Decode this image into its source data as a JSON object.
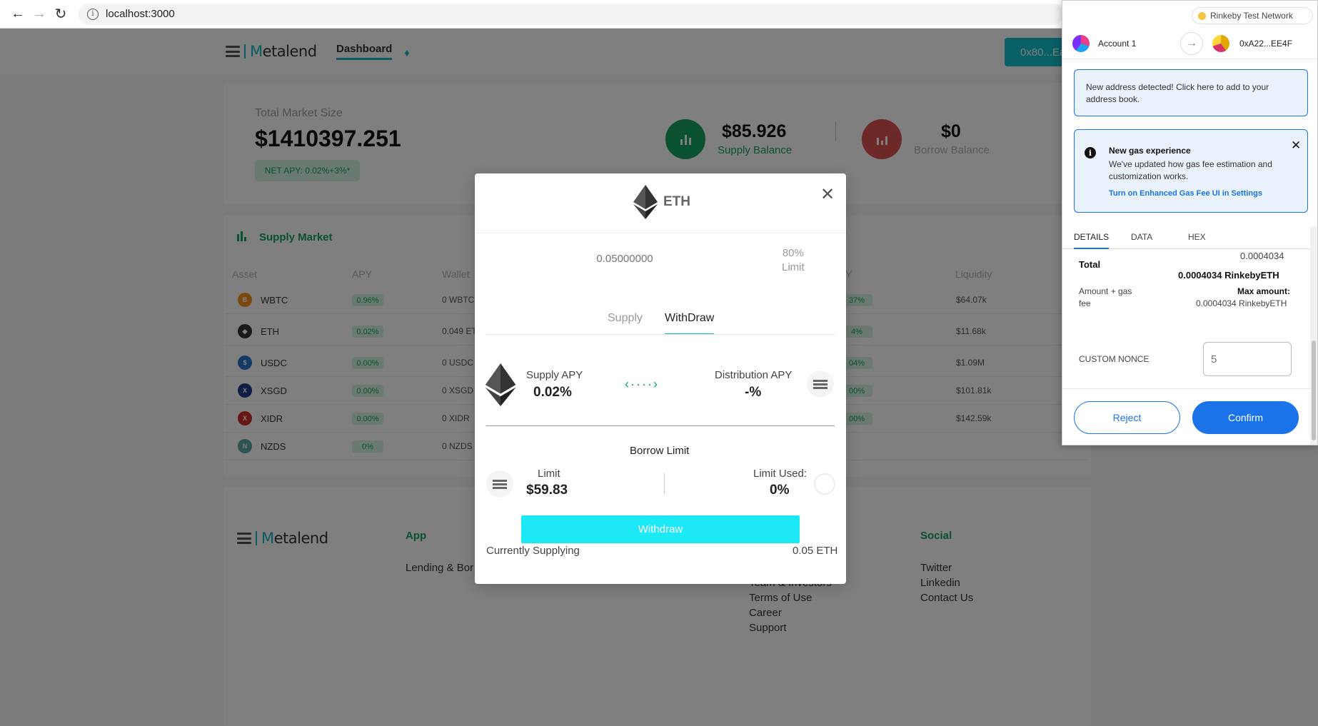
{
  "browser": {
    "url": "localhost:3000"
  },
  "header": {
    "logo_prefix": "M",
    "logo_rest": "etalend",
    "nav_dashboard": "Dashboard",
    "account_button": "0x80...Ea"
  },
  "market": {
    "total_label": "Total Market Size",
    "total_value": "$1410397.251",
    "net_apy": "NET APY: 0.02%+3%*",
    "supply_balance_value": "$85.926",
    "supply_balance_label": "Supply Balance",
    "borrow_balance_value": "$0",
    "borrow_balance_label": "Borrow Balance"
  },
  "supply_market": {
    "title": "Supply Market",
    "headers": {
      "asset": "Asset",
      "apy": "APY",
      "wallet": "Wallet",
      "apy2": "Y",
      "liquidity": "Liquidity"
    },
    "rows": [
      {
        "name": "WBTC",
        "apy": "0.96%",
        "wallet": "0 WBTC",
        "borrow_apy": "37%",
        "liquidity": "$64.07k",
        "color": "#f7931a",
        "glyph": "B"
      },
      {
        "name": "ETH",
        "apy": "0.02%",
        "wallet": "0.049 ET",
        "borrow_apy": "4%",
        "liquidity": "$11.68k",
        "color": "#333333",
        "glyph": "◆"
      },
      {
        "name": "USDC",
        "apy": "0.00%",
        "wallet": "0 USDC",
        "borrow_apy": "04%",
        "liquidity": "$1.09M",
        "color": "#2775ca",
        "glyph": "$"
      },
      {
        "name": "XSGD",
        "apy": "0.00%",
        "wallet": "0 XSGD",
        "borrow_apy": "00%",
        "liquidity": "$101.81k",
        "color": "#1d3c8f",
        "glyph": "X"
      },
      {
        "name": "XIDR",
        "apy": "0.00%",
        "wallet": "0 XIDR",
        "borrow_apy": "00%",
        "liquidity": "$142.59k",
        "color": "#d12b2b",
        "glyph": "X"
      },
      {
        "name": "NZDS",
        "apy": "0%",
        "wallet": "0 NZDS",
        "borrow_apy": "",
        "liquidity": "",
        "color": "#5aa6a0",
        "glyph": "N"
      }
    ]
  },
  "footer": {
    "app_title": "App",
    "app_link": "Lending & Bor",
    "company_partial": "Team & Investors",
    "company_links": [
      "Terms of Use",
      "Career",
      "Support"
    ],
    "social_title": "Social",
    "social_links": [
      "Twitter",
      "Linkedin",
      "Contact Us"
    ]
  },
  "modal": {
    "asset": "ETH",
    "amount_placeholder": "0.05000000",
    "limit_pct": "80%",
    "limit_label": "Limit",
    "tab_supply": "Supply",
    "tab_withdraw": "WithDraw",
    "supply_apy_label": "Supply APY",
    "supply_apy_value": "0.02%",
    "dist_apy_label": "Distribution APY",
    "dist_apy_value": "-%",
    "borrow_limit_title": "Borrow Limit",
    "limit_title": "Limit",
    "limit_value": "$59.83",
    "limit_used_label": "Limit Used:",
    "limit_used_value": "0%",
    "withdraw_button": "Withdraw",
    "currently_supplying_label": "Currently Supplying",
    "currently_supplying_value": "0.05 ETH",
    "close_icon": "close-icon"
  },
  "metamask": {
    "network": "Rinkeby Test Network",
    "from_account": "Account 1",
    "to_address": "0xA22...EE4F",
    "notice_address": "New address detected! Click here to add to your address book.",
    "gas_title": "New gas experience",
    "gas_body": "We've updated how gas fee estimation and customization works.",
    "gas_link": "Turn on Enhanced Gas Fee UI in Settings",
    "tabs": [
      "DETAILS",
      "DATA",
      "HEX"
    ],
    "total_top": "0.0004034",
    "total_label": "Total",
    "total_value": "0.0004034 RinkebyETH",
    "amount_gas_label_1": "Amount + gas",
    "amount_gas_label_2": "fee",
    "max_amount_label": "Max amount:",
    "max_amount_value": "0.0004034 RinkebyETH",
    "custom_nonce_label": "CUSTOM NONCE",
    "nonce_placeholder": "5",
    "reject": "Reject",
    "confirm": "Confirm"
  },
  "colors": {
    "accent": "#16b6c4",
    "green": "#13a35f",
    "red": "#d9534f",
    "metamask_blue": "#1a73e8"
  }
}
